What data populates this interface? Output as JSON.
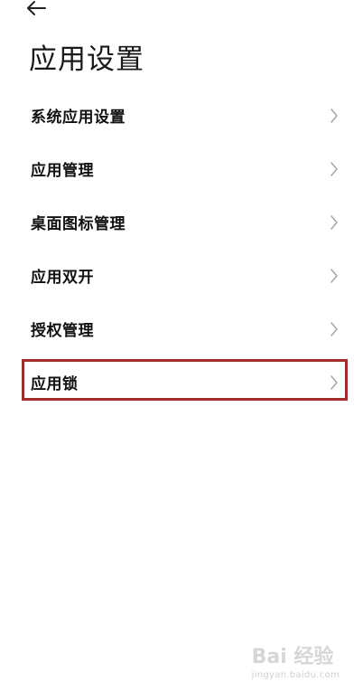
{
  "header": {
    "back_icon": "arrow-left-icon",
    "title": "应用设置"
  },
  "settings": {
    "items": [
      {
        "label": "系统应用设置",
        "icon": "chevron-right-icon"
      },
      {
        "label": "应用管理",
        "icon": "chevron-right-icon"
      },
      {
        "label": "桌面图标管理",
        "icon": "chevron-right-icon"
      },
      {
        "label": "应用双开",
        "icon": "chevron-right-icon"
      },
      {
        "label": "授权管理",
        "icon": "chevron-right-icon"
      },
      {
        "label": "应用锁",
        "icon": "chevron-right-icon",
        "highlighted": true
      }
    ]
  },
  "highlight": {
    "color": "#a52a2a"
  },
  "watermark": {
    "brand": "Bai 经验",
    "url": "jingyan.baidu.com"
  }
}
